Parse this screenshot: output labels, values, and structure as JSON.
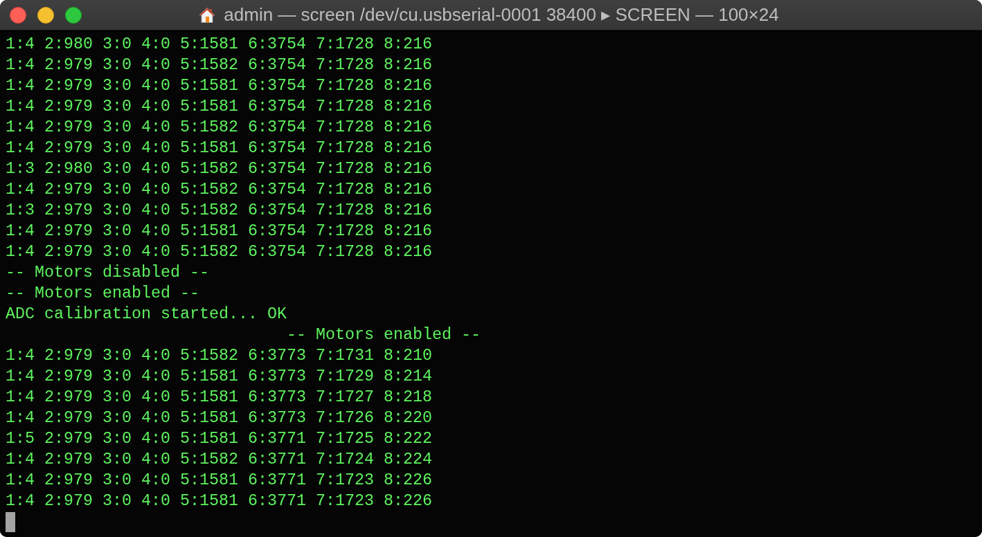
{
  "window": {
    "title": "admin — screen /dev/cu.usbserial-0001 38400 ▸ SCREEN — 100×24"
  },
  "terminal": {
    "lines": [
      {
        "kind": "output",
        "text": "1:4 2:980 3:0 4:0 5:1581 6:3754 7:1728 8:216"
      },
      {
        "kind": "output",
        "text": "1:4 2:979 3:0 4:0 5:1582 6:3754 7:1728 8:216"
      },
      {
        "kind": "output",
        "text": "1:4 2:979 3:0 4:0 5:1581 6:3754 7:1728 8:216"
      },
      {
        "kind": "output",
        "text": "1:4 2:979 3:0 4:0 5:1581 6:3754 7:1728 8:216"
      },
      {
        "kind": "output",
        "text": "1:4 2:979 3:0 4:0 5:1582 6:3754 7:1728 8:216"
      },
      {
        "kind": "output",
        "text": "1:4 2:979 3:0 4:0 5:1581 6:3754 7:1728 8:216"
      },
      {
        "kind": "output",
        "text": "1:3 2:980 3:0 4:0 5:1582 6:3754 7:1728 8:216"
      },
      {
        "kind": "output",
        "text": "1:4 2:979 3:0 4:0 5:1582 6:3754 7:1728 8:216"
      },
      {
        "kind": "output",
        "text": "1:3 2:979 3:0 4:0 5:1582 6:3754 7:1728 8:216"
      },
      {
        "kind": "output",
        "text": "1:4 2:979 3:0 4:0 5:1581 6:3754 7:1728 8:216"
      },
      {
        "kind": "output",
        "text": "1:4 2:979 3:0 4:0 5:1582 6:3754 7:1728 8:216"
      },
      {
        "kind": "output",
        "text": "-- Motors disabled --"
      },
      {
        "kind": "output",
        "text": "-- Motors enabled --"
      },
      {
        "kind": "output",
        "text": "ADC calibration started... OK"
      },
      {
        "kind": "indented",
        "text": "-- Motors enabled --"
      },
      {
        "kind": "output",
        "text": "1:4 2:979 3:0 4:0 5:1582 6:3773 7:1731 8:210"
      },
      {
        "kind": "output",
        "text": "1:4 2:979 3:0 4:0 5:1581 6:3773 7:1729 8:214"
      },
      {
        "kind": "output",
        "text": "1:4 2:979 3:0 4:0 5:1581 6:3773 7:1727 8:218"
      },
      {
        "kind": "output",
        "text": "1:4 2:979 3:0 4:0 5:1581 6:3773 7:1726 8:220"
      },
      {
        "kind": "output",
        "text": "1:5 2:979 3:0 4:0 5:1581 6:3771 7:1725 8:222"
      },
      {
        "kind": "output",
        "text": "1:4 2:979 3:0 4:0 5:1582 6:3771 7:1724 8:224"
      },
      {
        "kind": "output",
        "text": "1:4 2:979 3:0 4:0 5:1581 6:3771 7:1723 8:226"
      },
      {
        "kind": "output",
        "text": "1:4 2:979 3:0 4:0 5:1581 6:3771 7:1723 8:226"
      }
    ]
  }
}
